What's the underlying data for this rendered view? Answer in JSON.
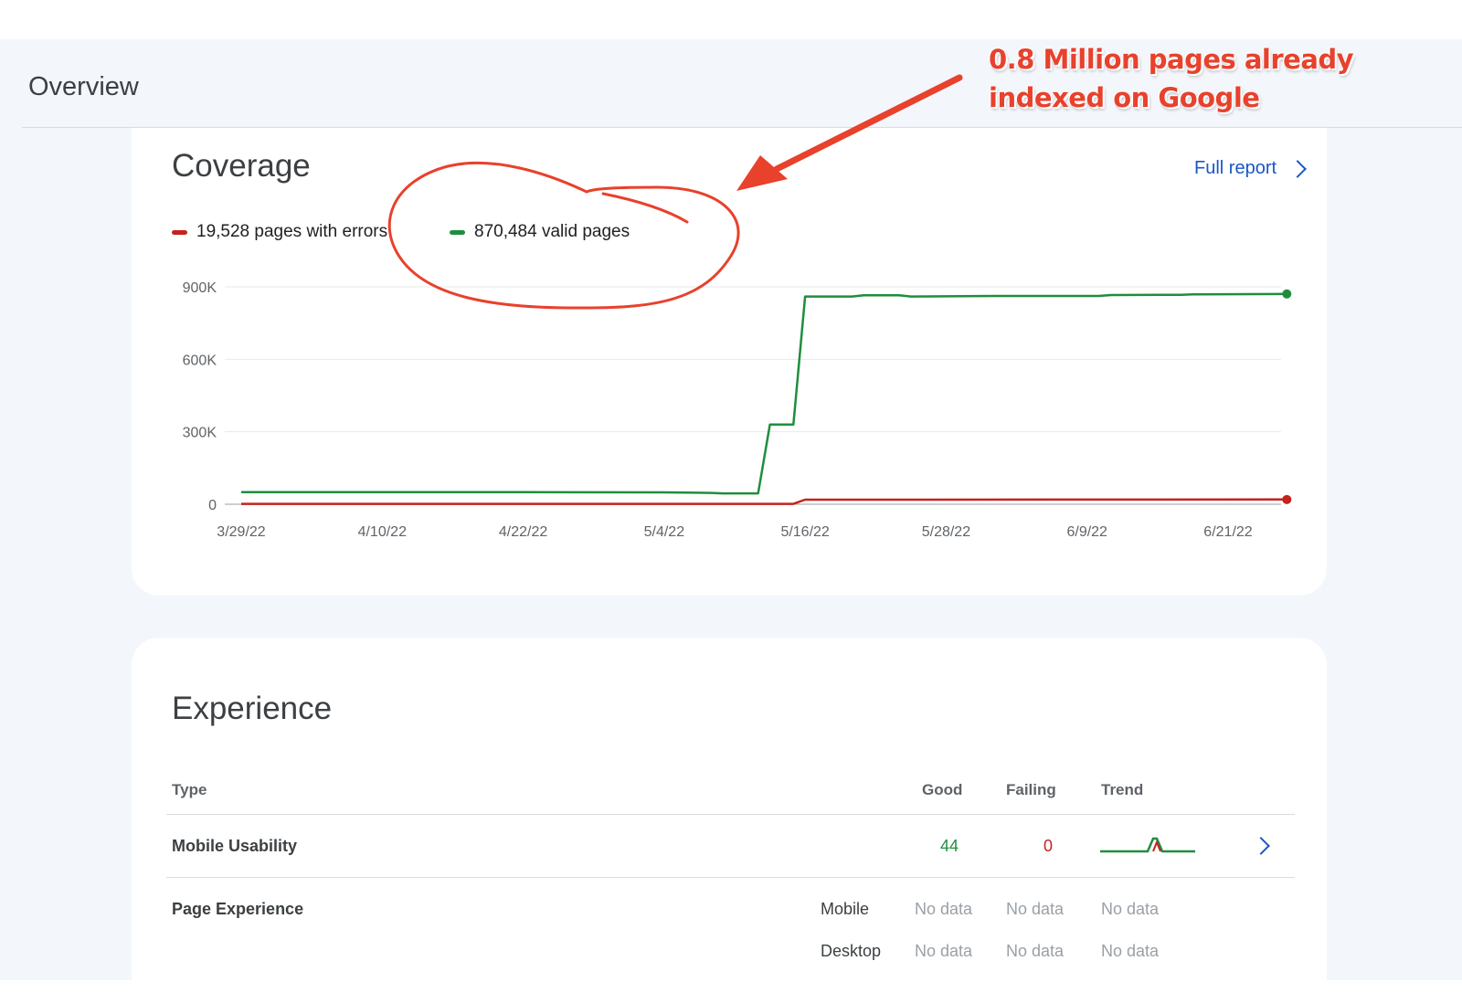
{
  "page": {
    "title": "Overview"
  },
  "annotation": {
    "line1": "0.8 Million pages already",
    "line2": "indexed on Google",
    "color": "#e8412c"
  },
  "coverage": {
    "title": "Coverage",
    "full_report_label": "Full report",
    "legend": [
      {
        "label": "19,528 pages with errors",
        "color": "#c5221f"
      },
      {
        "label": "870,484 valid pages",
        "color": "#1e8e3e"
      }
    ]
  },
  "chart_data": {
    "type": "line",
    "title": "",
    "xlabel": "",
    "ylabel": "",
    "ylim": [
      0,
      900000
    ],
    "y_ticks": [
      {
        "value": 0,
        "label": "0"
      },
      {
        "value": 300000,
        "label": "300K"
      },
      {
        "value": 600000,
        "label": "600K"
      },
      {
        "value": 900000,
        "label": "900K"
      }
    ],
    "x_tick_labels": [
      "3/29/22",
      "4/10/22",
      "4/22/22",
      "5/4/22",
      "5/16/22",
      "5/28/22",
      "6/9/22",
      "6/21/22"
    ],
    "x_tick_dates": [
      "2022-03-29",
      "2022-04-10",
      "2022-04-22",
      "2022-05-04",
      "2022-05-16",
      "2022-05-28",
      "2022-06-09",
      "2022-06-21"
    ],
    "grid": true,
    "legend_position": "top-left",
    "series": [
      {
        "name": "870,484 valid pages",
        "color": "#1e8e3e",
        "points": [
          [
            "2022-03-29",
            50000
          ],
          [
            "2022-04-10",
            50000
          ],
          [
            "2022-04-22",
            50000
          ],
          [
            "2022-05-04",
            49000
          ],
          [
            "2022-05-08",
            47000
          ],
          [
            "2022-05-09",
            45000
          ],
          [
            "2022-05-12",
            45000
          ],
          [
            "2022-05-13",
            330000
          ],
          [
            "2022-05-15",
            330000
          ],
          [
            "2022-05-16",
            860000
          ],
          [
            "2022-05-20",
            860000
          ],
          [
            "2022-05-21",
            865000
          ],
          [
            "2022-05-24",
            865000
          ],
          [
            "2022-05-25",
            860000
          ],
          [
            "2022-06-01",
            862000
          ],
          [
            "2022-06-10",
            862000
          ],
          [
            "2022-06-11",
            866000
          ],
          [
            "2022-06-17",
            867000
          ],
          [
            "2022-06-18",
            869000
          ],
          [
            "2022-06-26",
            870484
          ]
        ]
      },
      {
        "name": "19,528 pages with errors",
        "color": "#c5221f",
        "points": [
          [
            "2022-03-29",
            1500
          ],
          [
            "2022-05-15",
            1500
          ],
          [
            "2022-05-16",
            19000
          ],
          [
            "2022-06-26",
            19528
          ]
        ]
      }
    ]
  },
  "experience": {
    "title": "Experience",
    "columns": {
      "type": "Type",
      "good": "Good",
      "failing": "Failing",
      "trend": "Trend"
    },
    "rows": [
      {
        "type": "Mobile Usability",
        "good": "44",
        "failing": "0"
      },
      {
        "type": "Page Experience",
        "subrows": [
          {
            "device": "Mobile",
            "good": "No data",
            "failing": "No data",
            "trend": "No data"
          },
          {
            "device": "Desktop",
            "good": "No data",
            "failing": "No data",
            "trend": "No data"
          }
        ]
      }
    ]
  }
}
